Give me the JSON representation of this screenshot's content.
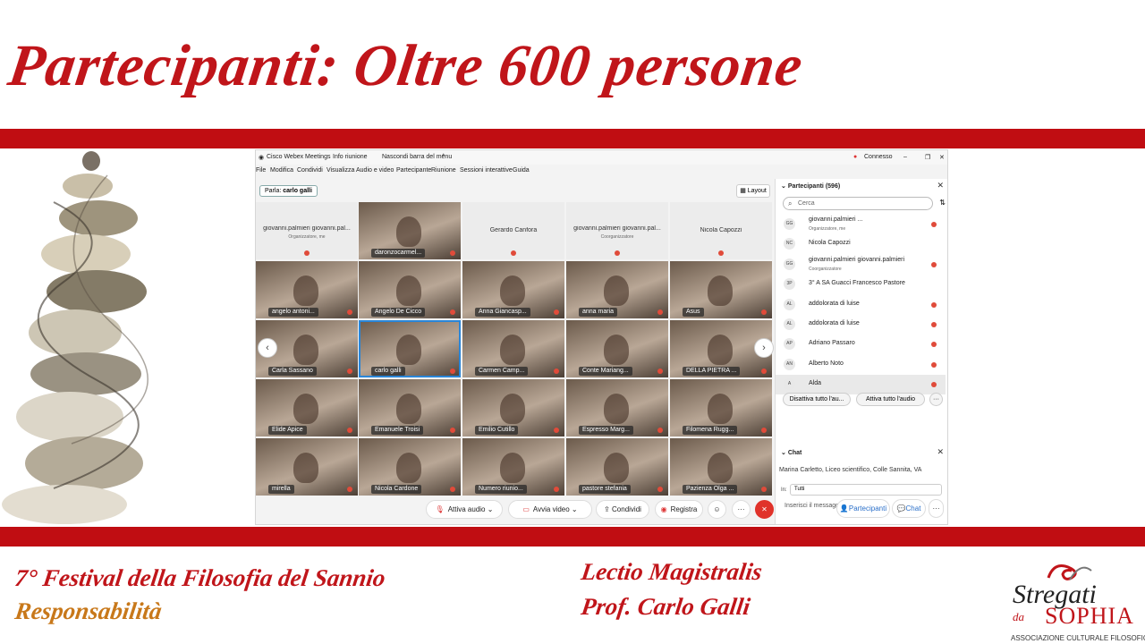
{
  "slide": {
    "title": "Partecipanti: Oltre 600 persone",
    "footer_festival": "7° Festival della Filosofia del Sannio",
    "footer_theme": "Responsabilità",
    "footer_lectio": "Lectio Magistralis",
    "footer_prof": "Prof. Carlo Galli",
    "logo_word1": "Stregati",
    "logo_word2": "da",
    "logo_word3": "SOPHIA",
    "logo_subtitle": "ASSOCIAZIONE CULTURALE FILOSOFICA",
    "accent_color": "#c00d12",
    "accent_orange": "#c8781a"
  },
  "webex": {
    "app_name": "Cisco Webex Meetings",
    "meeting_info": "Info riunione",
    "hide_menu": "Nascondi barra del menu",
    "status": "Connesso",
    "menu": [
      "File",
      "Modifica",
      "Condividi",
      "Visualizza",
      "Audio e video",
      "Partecipante",
      "Riunione",
      "Sessioni interattive",
      "Guida"
    ],
    "speaker_label": "Parla:",
    "speaker_name": "carlo galli",
    "layout_label": "Layout",
    "tiles": [
      {
        "name": "giovanni.palmieri giovanni.pal...",
        "role": "Organizzatore, me",
        "kind": "plain"
      },
      {
        "name": "daronzocarmel...",
        "kind": "cam"
      },
      {
        "name": "Gerardo Canfora",
        "kind": "plain"
      },
      {
        "name": "giovanni.palmieri giovanni.pal...",
        "role": "Coorganizzatore",
        "kind": "plain"
      },
      {
        "name": "Nicola Capozzi",
        "kind": "plain"
      },
      {
        "name": "angelo antoni...",
        "kind": "cam"
      },
      {
        "name": "Angelo De Cicco",
        "kind": "cam"
      },
      {
        "name": "Anna Giancasp...",
        "kind": "cam"
      },
      {
        "name": "anna maria",
        "kind": "cam"
      },
      {
        "name": "Asus",
        "kind": "cam"
      },
      {
        "name": "Carla Sassano",
        "kind": "cam"
      },
      {
        "name": "carlo galli",
        "kind": "cam",
        "active": true
      },
      {
        "name": "Carmen Camp...",
        "kind": "cam"
      },
      {
        "name": "Conte Mariang...",
        "kind": "cam"
      },
      {
        "name": "DELLA PIETRA ...",
        "kind": "cam"
      },
      {
        "name": "Elide Apice",
        "kind": "cam"
      },
      {
        "name": "Emanuele Troisi",
        "kind": "cam"
      },
      {
        "name": "Emilio Cutillo",
        "kind": "cam"
      },
      {
        "name": "Espresso Marg...",
        "kind": "cam"
      },
      {
        "name": "Filomena Rugg...",
        "kind": "cam"
      },
      {
        "name": "mirella",
        "kind": "cam"
      },
      {
        "name": "Nicola Cardone",
        "kind": "cam"
      },
      {
        "name": "Numero riunio...",
        "kind": "cam"
      },
      {
        "name": "pastore stefania",
        "kind": "cam"
      },
      {
        "name": "Pazienza Olga ...",
        "kind": "cam"
      }
    ],
    "toolbar": {
      "audio": "Attiva audio",
      "video": "Avvia video",
      "share": "Condividi",
      "record": "Registra",
      "participants": "Partecipanti",
      "chat": "Chat",
      "more": "···"
    },
    "participants_panel": {
      "title": "Partecipanti (596)",
      "search_placeholder": "Cerca",
      "list": [
        {
          "initials": "GG",
          "name": "giovanni.palmieri ...",
          "role": "Organizzatore, me"
        },
        {
          "initials": "NC",
          "name": "Nicola Capozzi",
          "role": ""
        },
        {
          "initials": "GG",
          "name": "giovanni.palmieri giovanni.palmieri",
          "role": "Coorganizzatore"
        },
        {
          "initials": "3P",
          "name": "3° A SA Guacci Francesco Pastore",
          "role": ""
        },
        {
          "initials": "AL",
          "name": "addolorata di luise",
          "role": ""
        },
        {
          "initials": "AL",
          "name": "addolorata di luise",
          "role": ""
        },
        {
          "initials": "AP",
          "name": "Adriano Passaro",
          "role": ""
        },
        {
          "initials": "AN",
          "name": "Alberto Noto",
          "role": ""
        },
        {
          "initials": "A",
          "name": "Alda",
          "role": ""
        }
      ],
      "mute_all": "Disattiva tutto l'au...",
      "unmute_all": "Attiva tutto l'audio"
    },
    "chat": {
      "title": "Chat",
      "message": "Marina Carletto, Liceo scientifico, Colle Sannita, VA",
      "to_label": "In:",
      "to_value": "Tutti",
      "input_placeholder": "Inserisci il messaggio di chat qui"
    }
  }
}
